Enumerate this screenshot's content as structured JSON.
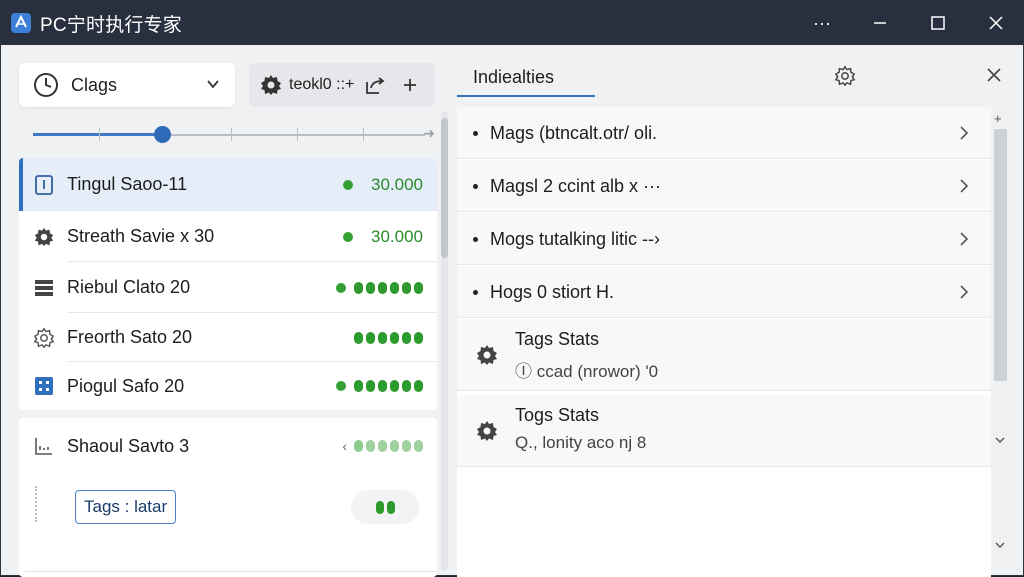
{
  "window": {
    "title": "PC宁时执行专家",
    "controls": {
      "menu": "···",
      "minimize": "—",
      "maximize": "☐",
      "close": "✕"
    }
  },
  "left": {
    "dropdown": {
      "label": "Clags",
      "icon": "clock-icon"
    },
    "toolbar": {
      "label": "teokl0 ::+",
      "icons": [
        "gear-icon",
        "share-icon",
        "plus-icon"
      ]
    },
    "slider": {
      "value_fraction": 0.33
    },
    "items": [
      {
        "label": "Tingul Saoo-11",
        "value": "30.000",
        "icon": "info-icon",
        "selected": true,
        "indicator": "dot-value"
      },
      {
        "label": "Streath Savie x 30",
        "value": "30.000",
        "icon": "gear-icon",
        "selected": false,
        "indicator": "dot-value"
      },
      {
        "label": "Riebul Clato 20",
        "value": "",
        "icon": "server-icon",
        "selected": false,
        "indicator": "dot-pips"
      },
      {
        "label": "Freorth Sato 20",
        "value": "",
        "icon": "cog-outline-icon",
        "selected": false,
        "indicator": "pips"
      },
      {
        "label": "Piogul Safo 20",
        "value": "",
        "icon": "grid-icon",
        "selected": false,
        "indicator": "dot-pips"
      }
    ],
    "card": {
      "label": "Shaoul Savto 3",
      "icon": "chart-icon",
      "lt": "‹",
      "tags_button": "Tags : latar"
    }
  },
  "right": {
    "tab": "Indiealties",
    "items": [
      {
        "label": "Mags (btncalt.otr/ oli."
      },
      {
        "label": "Magsl 2 ccint alb x ···"
      },
      {
        "label": "Mogs tutalking litic --›"
      },
      {
        "label": "Hogs 0 stiort H."
      }
    ],
    "stats": [
      {
        "title": "Tags Stats",
        "sub": "Ⓘ ccad (nrowor) '0"
      },
      {
        "title": "Togs Stats",
        "sub": "Q., lonity aco nj 8"
      }
    ]
  },
  "colors": {
    "titlebar": "#283040",
    "accent": "#2f6fc0",
    "green": "#34a034",
    "selected_bg": "#e5edf9"
  }
}
